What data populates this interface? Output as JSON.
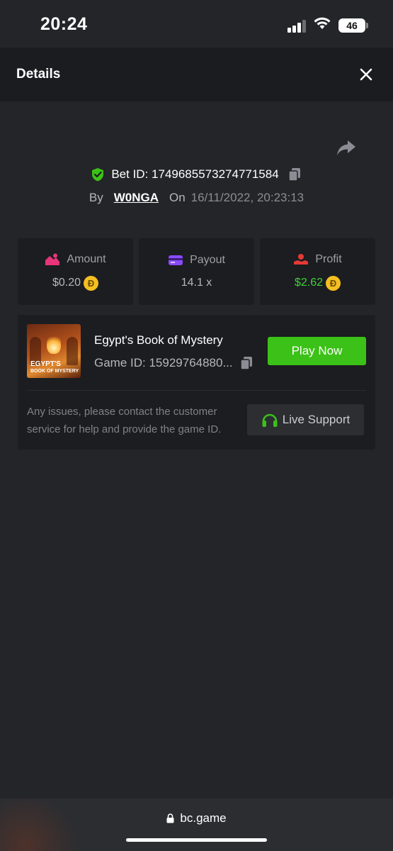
{
  "status_bar": {
    "time": "20:24",
    "battery": "46"
  },
  "header": {
    "title": "Details"
  },
  "bet": {
    "id_label": "Bet ID:",
    "id_value": "1749685573274771584",
    "by_label": "By",
    "user": "W0NGA",
    "on_label": "On",
    "date": "16/11/2022, 20:23:13"
  },
  "stats": {
    "amount": {
      "label": "Amount",
      "value": "$0.20",
      "coin": "Đ"
    },
    "payout": {
      "label": "Payout",
      "value": "14.1 x"
    },
    "profit": {
      "label": "Profit",
      "value": "$2.62",
      "coin": "Đ"
    }
  },
  "game": {
    "thumb_title": "EGYPT'S",
    "thumb_subtitle": "BOOK OF MYSTERY",
    "name": "Egypt's Book of Mystery",
    "id_text": "Game ID: 15929764880...",
    "play_label": "Play Now",
    "issues_text": "Any issues, please contact the customer service for help and provide the game ID.",
    "support_label": "Live Support"
  },
  "browser": {
    "url": "bc.game"
  },
  "colors": {
    "accent_green": "#3bc117",
    "profit_green": "#3ed135",
    "coin_gold": "#f4bf21",
    "amount_pink": "#e8347a",
    "payout_purple": "#8a4bff",
    "profit_red": "#e53935"
  },
  "icons": [
    "shield-check-icon",
    "copy-icon",
    "share-icon",
    "close-icon",
    "amount-icon",
    "payout-icon",
    "profit-icon",
    "headset-icon",
    "lock-icon"
  ]
}
